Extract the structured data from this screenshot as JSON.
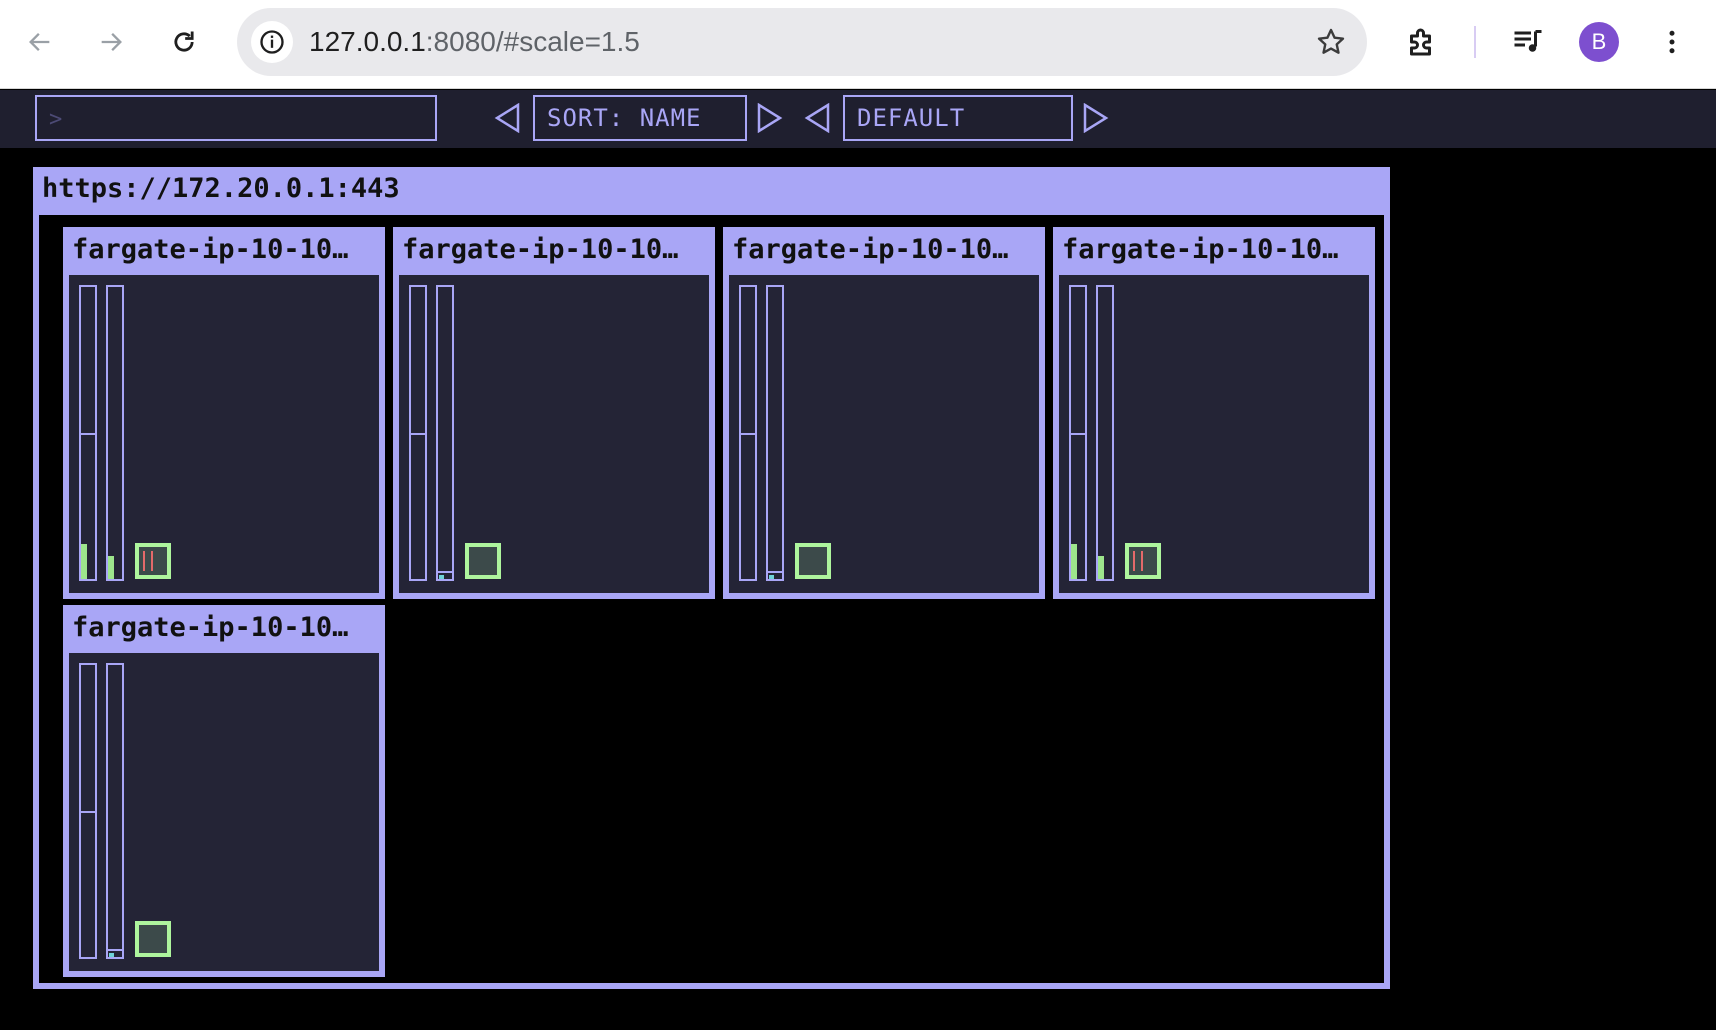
{
  "browser": {
    "url_host": "127.0.0.1",
    "url_rest": ":8080/#scale=1.5",
    "profile_initial": "B",
    "icons": [
      "back-icon",
      "forward-icon",
      "reload-icon",
      "info-icon",
      "star-icon",
      "extensions-icon",
      "media-icon",
      "menu-icon"
    ]
  },
  "toolbar": {
    "filter_prompt": ">",
    "sort_label": "SORT: NAME",
    "group_label": "DEFAULT"
  },
  "cluster": {
    "url": "https://172.20.0.1:443",
    "nodes": [
      {
        "name": "fargate-ip-10-10…",
        "cpu_level": 0.12,
        "mem_level": 0.08,
        "pod_status": "error"
      },
      {
        "name": "fargate-ip-10-10…",
        "cpu_level": 0.0,
        "mem_level": 0.03,
        "pod_status": "ok"
      },
      {
        "name": "fargate-ip-10-10…",
        "cpu_level": 0.0,
        "mem_level": 0.03,
        "pod_status": "ok"
      },
      {
        "name": "fargate-ip-10-10…",
        "cpu_level": 0.12,
        "mem_level": 0.08,
        "pod_status": "error"
      },
      {
        "name": "fargate-ip-10-10…",
        "cpu_level": 0.0,
        "mem_level": 0.03,
        "pod_status": "ok"
      }
    ]
  },
  "colors": {
    "accent": "#a9a6f6",
    "pod_ok": "#aef59d",
    "pod_error": "#e46a6a",
    "node_bg": "#242436"
  }
}
